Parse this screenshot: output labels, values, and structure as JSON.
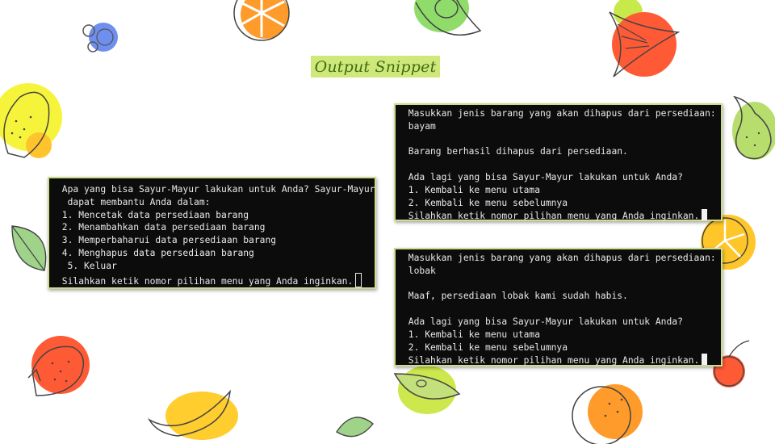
{
  "title": "Output Snippet",
  "terminal_left": {
    "lines": [
      " Apa yang bisa Sayur-Mayur lakukan untuk Anda? Sayur-Mayur",
      "  dapat membantu Anda dalam:",
      " 1. Mencetak data persediaan barang",
      " 2. Menambahkan data persediaan barang",
      " 3. Memperbaharui data persediaan barang",
      " 4. Menghapus data persediaan barang",
      "  5. Keluar",
      " Silahkan ketik nomor pilihan menu yang Anda inginkan."
    ]
  },
  "terminal_top_right": {
    "lines": [
      " Masukkan jenis barang yang akan dihapus dari persediaan:",
      " bayam",
      "",
      " Barang berhasil dihapus dari persediaan.",
      "",
      " Ada lagi yang bisa Sayur-Mayur lakukan untuk Anda?",
      " 1. Kembali ke menu utama",
      " 2. Kembali ke menu sebelumnya",
      " Silahkan ketik nomor pilihan menu yang Anda inginkan."
    ]
  },
  "terminal_bottom_right": {
    "lines": [
      " Masukkan jenis barang yang akan dihapus dari persediaan:",
      " lobak",
      "",
      " Maaf, persediaan lobak kami sudah habis.",
      "",
      " Ada lagi yang bisa Sayur-Mayur lakukan untuk Anda?",
      " 1. Kembali ke menu utama",
      " 2. Kembali ke menu sebelumnya",
      " Silahkan ketik nomor pilihan menu yang Anda inginkan."
    ]
  },
  "colors": {
    "terminal_bg": "#0c0c0c",
    "terminal_border": "#c9dd8c",
    "badge_bg": "#cfe87a",
    "badge_text": "#3f6b12"
  },
  "decorations": [
    "blueberry-icon",
    "orange-slice-icon",
    "avocado-icon",
    "watermelon-icon",
    "lemon-icon",
    "leaf-icon",
    "pear-icon",
    "lemon-slice-icon",
    "strawberry-icon",
    "banana-icon",
    "apple-slice-icon",
    "orange-icon",
    "cherry-icon"
  ]
}
